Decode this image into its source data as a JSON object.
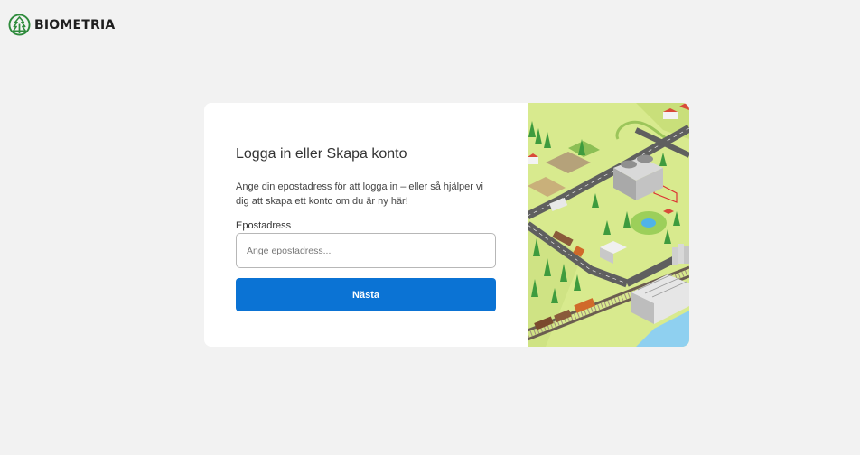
{
  "brand": {
    "name": "BIOMETRIA",
    "logo_icon": "tree-icon",
    "color": "#2e8b3c"
  },
  "login": {
    "title": "Logga in eller Skapa konto",
    "description": "Ange din epostadress för att logga in – eller så hjälper vi dig att skapa ett konto om du är ny här!",
    "email_label": "Epostadress",
    "email_placeholder": "Ange epostadress...",
    "email_value": "",
    "next_label": "Nästa",
    "accent_color": "#0b73d4"
  },
  "illustration": {
    "subject": "isometric-forestry-logistics-scene"
  }
}
